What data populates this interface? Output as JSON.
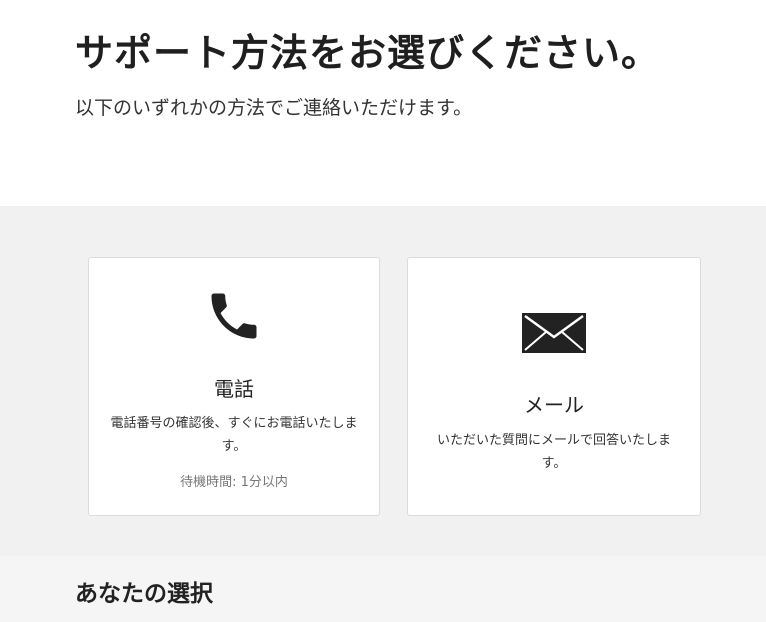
{
  "header": {
    "title": "サポート方法をお選びください。",
    "subtitle": "以下のいずれかの方法でご連絡いただけます。"
  },
  "options": {
    "phone": {
      "icon": "phone-icon",
      "title": "電話",
      "description": "電話番号の確認後、すぐにお電話いたします。",
      "wait": "待機時間: 1分以内"
    },
    "mail": {
      "icon": "envelope-icon",
      "title": "メール",
      "description": "いただいた質問にメールで回答いたします。"
    }
  },
  "selection": {
    "title": "あなたの選択"
  }
}
